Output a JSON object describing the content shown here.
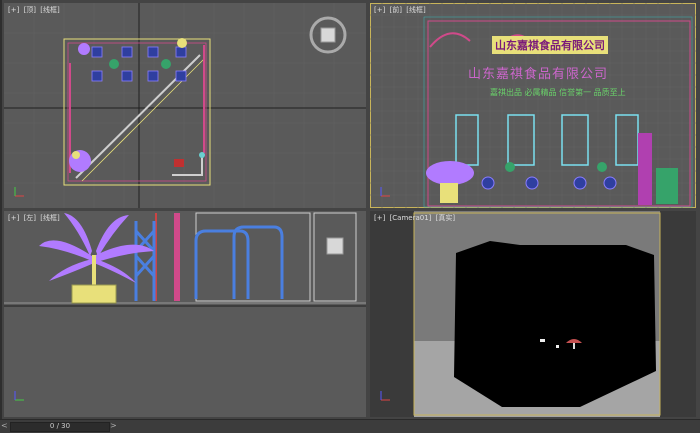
{
  "viewports": {
    "top": {
      "tags": [
        "[+]",
        "[顶]",
        "[线框]"
      ]
    },
    "front": {
      "tags": [
        "[+]",
        "[前]",
        "[线框]"
      ]
    },
    "left": {
      "tags": [
        "[+]",
        "[左]",
        "[线框]"
      ]
    },
    "camera": {
      "tags": [
        "[+]",
        "[Camera01]",
        "[真实]"
      ]
    }
  },
  "signage": {
    "main": "山东嘉祺食品有限公司",
    "board": "山东嘉祺食品有限公司",
    "slogan": "嘉祺出品  必属精品  信誉第一  品质至上"
  },
  "timeline": {
    "frame": "0 / 30"
  },
  "colors": {
    "active_border": "#c8b45a",
    "viewport_bg": "#5a5a5a",
    "signage": "#cc66cc"
  }
}
